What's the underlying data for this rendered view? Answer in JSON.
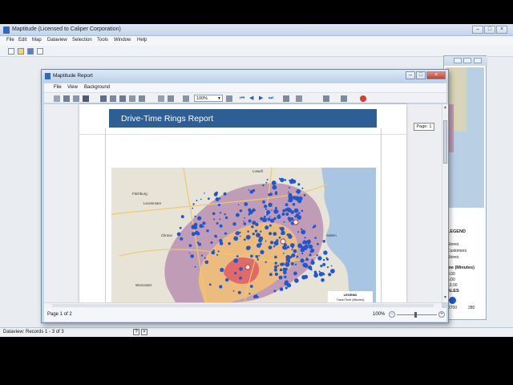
{
  "main_window": {
    "title": "Maptitude (Licensed to Caliper Corporation)",
    "menu": [
      "File",
      "Edit",
      "Map",
      "Dataview",
      "Selection",
      "Tools",
      "Window",
      "Help"
    ],
    "status": "Dataview: Records 1 - 3 of 3"
  },
  "report_window": {
    "title": "Maptitude Report",
    "menu": [
      "File",
      "View",
      "Background"
    ],
    "zoom_value": "100%",
    "page_status": "Page 1 of 2",
    "status_zoom": "100%",
    "page_tooltip": "Page: 1",
    "report_title": "Drive-Time Rings Report"
  },
  "map": {
    "places": [
      "Fitchburg",
      "Leominster",
      "Clinton",
      "Worcester",
      "Lowell",
      "Salem"
    ],
    "legend_title": "LEGEND",
    "legend_subtitle": "Travel Time (Minutes)"
  },
  "background_map": {
    "legend_title": "LEGEND",
    "legend_lines": [
      "Stores",
      "Customers",
      "Stores"
    ],
    "time_title": "me (Minutes)",
    "time_values": [
      "0.00",
      "5.00",
      "10.00"
    ],
    "sales_title": "ALES",
    "scale_values": [
      "2700",
      "280"
    ]
  },
  "colors": {
    "header": "#2d5e95",
    "ring_outer": "#b98fb0",
    "ring_mid": "#f0c078",
    "ring_inner": "#e06a6a",
    "water": "#a8c6e4",
    "land": "#e7e3d6",
    "customer_dot": "#1f57d0"
  }
}
